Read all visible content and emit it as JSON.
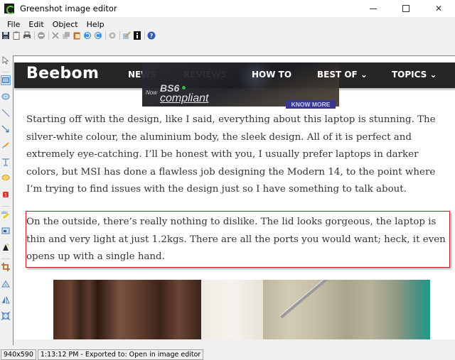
{
  "window": {
    "title": "Greenshot image editor",
    "controls": {
      "minimize": "minimize",
      "maximize": "maximize",
      "close": "✕"
    }
  },
  "menu": [
    "File",
    "Edit",
    "Object",
    "Help"
  ],
  "toolbar": {
    "icons": [
      "save-icon",
      "clipboard-icon",
      "print-icon",
      "delete-icon",
      "cut-icon",
      "copy-icon",
      "paste-icon",
      "undo-icon",
      "redo-icon",
      "settings-icon",
      "paint-icon",
      "info-icon",
      "help-icon"
    ]
  },
  "tools": [
    "cursor-tool",
    "rectangle-tool",
    "ellipse-tool",
    "line-tool",
    "arrow-tool",
    "freehand-tool",
    "text-tool",
    "speechbubble-tool",
    "counter-tool",
    "highlight-tool",
    "obfuscate-tool",
    "effects-tool",
    "crop-tool",
    "rotate-tool",
    "flip-tool",
    "resize-tool"
  ],
  "site": {
    "logo": "Beebom",
    "nav": [
      "NEWS",
      "REVIEWS",
      "HOW TO",
      "BEST OF ⌄",
      "TOPICS ⌄"
    ],
    "ad": {
      "now": "Now",
      "headline": "BS6",
      "subline": "compliant",
      "button": "KNOW MORE"
    }
  },
  "article": {
    "paragraph1": "Starting off with the design, like I said, everything about this laptop is stunning. The silver-white colour, the aluminium body, the sleek design. All of it is perfect and extremely eye-catching. I’ll be honest with you, I usually prefer laptops in darker colors, but MSI has done a flawless job designing the Modern 14, to the point where I’m trying to find issues with the design just so I have something to talk about.",
    "paragraph2": "On the outside, there’s really nothing to dislike. The lid looks gorgeous, the laptop is thin and very light at just 1.2kgs. There are all the ports you would want; heck, it even opens up with a single hand."
  },
  "annotation": {
    "color": "#c0222a"
  },
  "status": {
    "dimensions": "940x590",
    "message": "1:13:12 PM - Exported to: Open in image editor"
  }
}
